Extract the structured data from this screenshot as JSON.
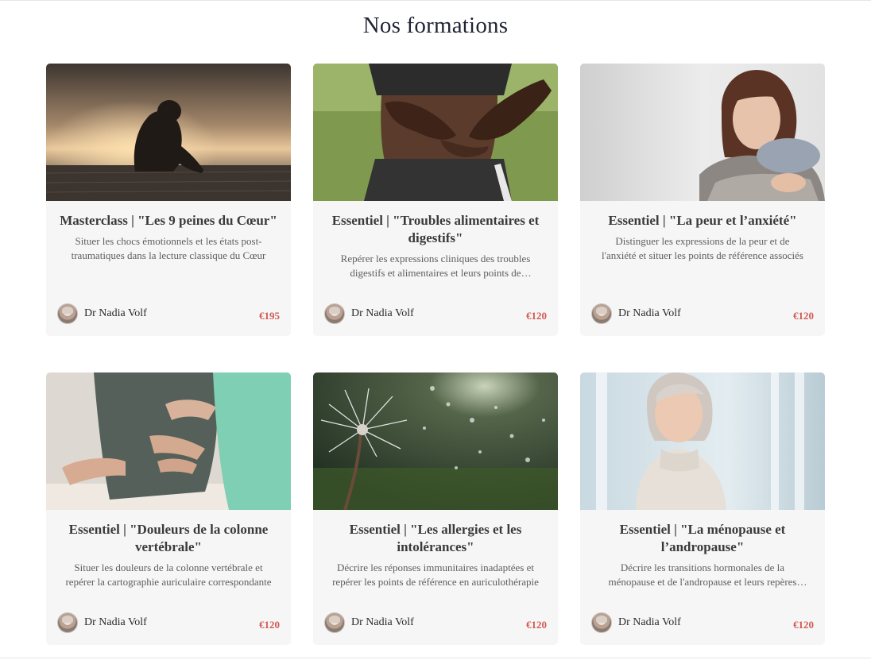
{
  "section": {
    "title": "Nos formations"
  },
  "cards": [
    {
      "title": "Masterclass | \"Les 9 peines du Cœur\"",
      "description": "Situer les chocs émotionnels et les états post-traumatiques dans la lecture classique du Cœur",
      "author": "Dr Nadia Volf",
      "price": "€195",
      "image": "silhouette-sunset-photo"
    },
    {
      "title": "Essentiel | \"Troubles alimentaires et digestifs\"",
      "description": "Repérer les expressions cliniques des troubles digestifs et alimentaires et leurs points de référence",
      "author": "Dr Nadia Volf",
      "price": "€120",
      "image": "hands-on-belly-photo"
    },
    {
      "title": "Essentiel | \"La peur et l’anxiété\"",
      "description": "Distinguer les expressions de la peur et de l'anxiété et situer les points de référence associés",
      "author": "Dr Nadia Volf",
      "price": "€120",
      "image": "anxious-woman-photo"
    },
    {
      "title": "Essentiel | \"Douleurs de la colonne vertébrale\"",
      "description": "Situer les douleurs de la colonne vertébrale et repérer la cartographie auriculaire correspondante",
      "author": "Dr Nadia Volf",
      "price": "€120",
      "image": "back-pain-photo"
    },
    {
      "title": "Essentiel | \"Les allergies et les intolérances\"",
      "description": "Décrire les réponses immunitaires inadaptées et repérer les points de référence en auriculothérapie",
      "author": "Dr Nadia Volf",
      "price": "€120",
      "image": "dandelion-photo"
    },
    {
      "title": "Essentiel | \"La ménopause et l’andropause\"",
      "description": "Décrire les transitions hormonales de la ménopause et de l'andropause et leurs repères auriculaires",
      "author": "Dr Nadia Volf",
      "price": "€120",
      "image": "senior-woman-photo"
    }
  ]
}
